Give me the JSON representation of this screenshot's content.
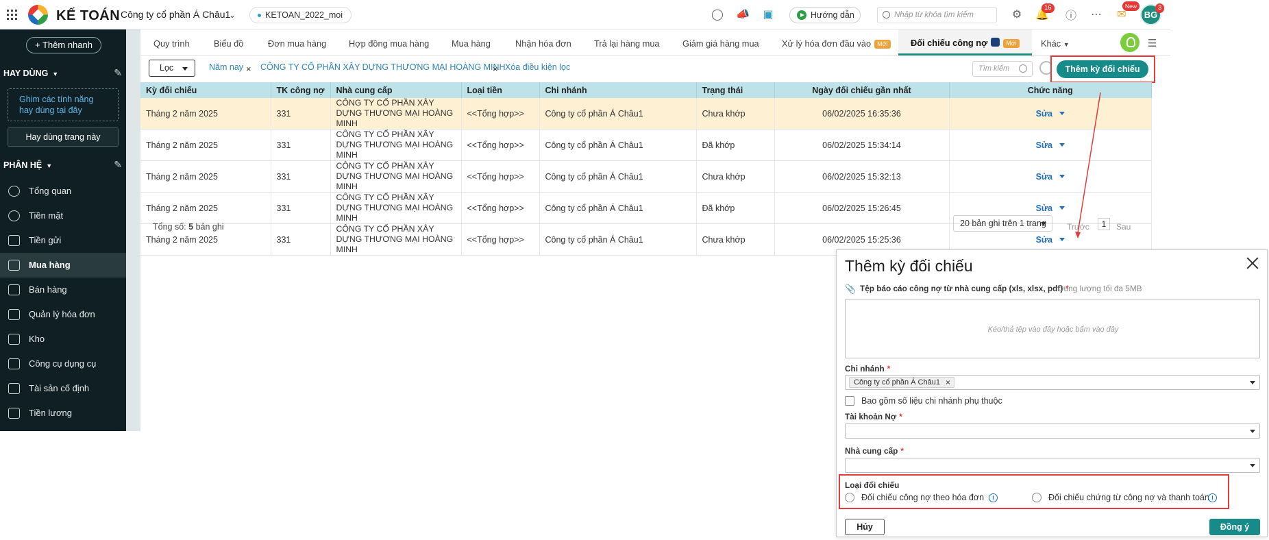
{
  "topbar": {
    "brand": "KẾ TOÁN",
    "company": "Công ty cổ phần Á Châu1",
    "database": "KETOAN_2022_moi",
    "guide_label": "Hướng dẫn",
    "search_placeholder": "Nhập từ khóa tìm kiếm",
    "notification_count": "16",
    "new_badge": "New",
    "avatar_initials": "BG",
    "avatar_badge": "3"
  },
  "sidebar": {
    "quick_add": "+ Thêm nhanh",
    "favorites_header": "HAY DÙNG",
    "pin_hint": "Ghim các tính năng hay dùng tại đây",
    "use_page": "Hay dùng trang này",
    "modules_header": "PHÂN HỆ",
    "items": [
      {
        "label": "Tổng quan",
        "icon": "dashboard-icon"
      },
      {
        "label": "Tiền mặt",
        "icon": "cash-bag-icon"
      },
      {
        "label": "Tiền gửi",
        "icon": "bank-icon"
      },
      {
        "label": "Mua hàng",
        "icon": "shopping-bag-icon",
        "active": true
      },
      {
        "label": "Bán hàng",
        "icon": "cart-icon"
      },
      {
        "label": "Quản lý hóa đơn",
        "icon": "invoice-icon"
      },
      {
        "label": "Kho",
        "icon": "warehouse-icon"
      },
      {
        "label": "Công cụ dụng cụ",
        "icon": "tools-icon"
      },
      {
        "label": "Tài sản cố định",
        "icon": "car-icon"
      },
      {
        "label": "Tiền lương",
        "icon": "payroll-icon"
      }
    ]
  },
  "tabs": [
    {
      "label": "Quy trình"
    },
    {
      "label": "Biểu đồ"
    },
    {
      "label": "Đơn mua hàng"
    },
    {
      "label": "Hợp đồng mua hàng"
    },
    {
      "label": "Mua hàng"
    },
    {
      "label": "Nhận hóa đơn"
    },
    {
      "label": "Trả lại hàng mua"
    },
    {
      "label": "Giảm giá hàng mua"
    },
    {
      "label": "Xử lý hóa đơn đầu vào",
      "badge": "Mới"
    },
    {
      "label": "Đối chiếu công nợ",
      "badge": "Mới",
      "active": true
    },
    {
      "label": "Khác"
    }
  ],
  "filter": {
    "button": "Lọc",
    "chip_year": "Năm nay",
    "chip_supplier": "CÔNG TY CỔ PHẦN XÂY DỰNG THƯƠNG MẠI HOÀNG MINH",
    "clear": "Xóa điều kiện lọc",
    "search_placeholder": "Tìm kiếm",
    "add_button": "Thêm kỳ đối chiếu"
  },
  "table": {
    "columns": [
      "Kỳ đối chiếu",
      "TK công nợ",
      "Nhà cung cấp",
      "Loại tiền",
      "Chi nhánh",
      "Trạng thái",
      "Ngày đối chiếu gần nhất",
      "Chức năng"
    ],
    "rows": [
      {
        "period": "Tháng 2 năm 2025",
        "account": "331",
        "supplier": "CÔNG TY CỔ PHẦN XÂY DỰNG THƯƠNG MẠI HOÀNG MINH",
        "currency": "<<Tổng hợp>>",
        "branch": "Công ty cổ phần Á Châu1",
        "status": "Chưa khớp",
        "status_kind": "warn",
        "date": "06/02/2025 16:35:36",
        "action": "Sửa"
      },
      {
        "period": "Tháng 2 năm 2025",
        "account": "331",
        "supplier": "CÔNG TY CỔ PHẦN XÂY DỰNG THƯƠNG MẠI HOÀNG MINH",
        "currency": "<<Tổng hợp>>",
        "branch": "Công ty cổ phần Á Châu1",
        "status": "Đã khớp",
        "status_kind": "ok",
        "date": "06/02/2025 15:34:14",
        "action": "Sửa"
      },
      {
        "period": "Tháng 2 năm 2025",
        "account": "331",
        "supplier": "CÔNG TY CỔ PHẦN XÂY DỰNG THƯƠNG MẠI HOÀNG MINH",
        "currency": "<<Tổng hợp>>",
        "branch": "Công ty cổ phần Á Châu1",
        "status": "Chưa khớp",
        "status_kind": "warn",
        "date": "06/02/2025 15:32:13",
        "action": "Sửa"
      },
      {
        "period": "Tháng 2 năm 2025",
        "account": "331",
        "supplier": "CÔNG TY CỔ PHẦN XÂY DỰNG THƯƠNG MẠI HOÀNG MINH",
        "currency": "<<Tổng hợp>>",
        "branch": "Công ty cổ phần Á Châu1",
        "status": "Đã khớp",
        "status_kind": "ok",
        "date": "06/02/2025 15:26:45",
        "action": "Sửa"
      },
      {
        "period": "Tháng 2 năm 2025",
        "account": "331",
        "supplier": "CÔNG TY CỔ PHẦN XÂY DỰNG THƯƠNG MẠI HOÀNG MINH",
        "currency": "<<Tổng hợp>>",
        "branch": "Công ty cổ phần Á Châu1",
        "status": "Chưa khớp",
        "status_kind": "warn",
        "date": "06/02/2025 15:25:36",
        "action": "Sửa"
      }
    ],
    "total_prefix": "Tổng số:",
    "total_count": "5",
    "total_suffix": "bản ghi",
    "page_size": "20 bản ghi trên 1 trang",
    "prev": "Trước",
    "page": "1",
    "next": "Sau"
  },
  "modal": {
    "title": "Thêm kỳ đối chiếu",
    "file_label": "Tệp báo cáo công nợ từ nhà cung cấp (xls, xlsx, pdf)",
    "file_hint": "Dung lượng tối đa 5MB",
    "dropzone": "Kéo/thả tệp vào đây hoặc bấm vào đây",
    "branch_label": "Chi nhánh",
    "branch_value": "Công ty cổ phần Á Châu1",
    "include_dependent": "Bao gồm số liệu chi nhánh phụ thuộc",
    "debit_account_label": "Tài khoản Nợ",
    "supplier_label": "Nhà cung cấp",
    "type_label": "Loại đối chiếu",
    "type_option_1": "Đối chiếu công nợ theo hóa đơn",
    "type_option_2": "Đối chiếu chứng từ công nợ và thanh toán",
    "cancel": "Hủy",
    "ok": "Đồng ý"
  },
  "colors": {
    "accent": "#178a8a",
    "sidebar_bg": "#0f1f23",
    "warn": "#e8733a",
    "ok": "#3e9a4b",
    "highlight": "#e33c3c"
  }
}
